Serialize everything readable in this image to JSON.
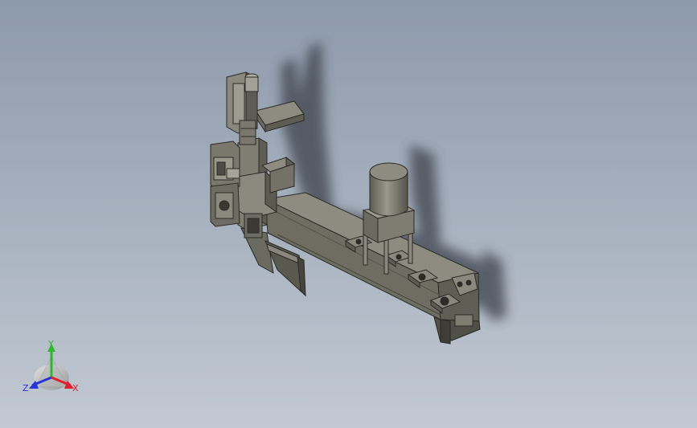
{
  "viewport": {
    "background_top": "#8d9aab",
    "background_bottom": "#c2c9d3"
  },
  "triad": {
    "x_label": "X",
    "y_label": "Y",
    "z_label": "Z",
    "x_color": "#e0202a",
    "y_color": "#2fb82f",
    "z_color": "#2434d8"
  },
  "model": {
    "body_color": "#7e7c6f",
    "shadow_color": "#3d434c"
  }
}
